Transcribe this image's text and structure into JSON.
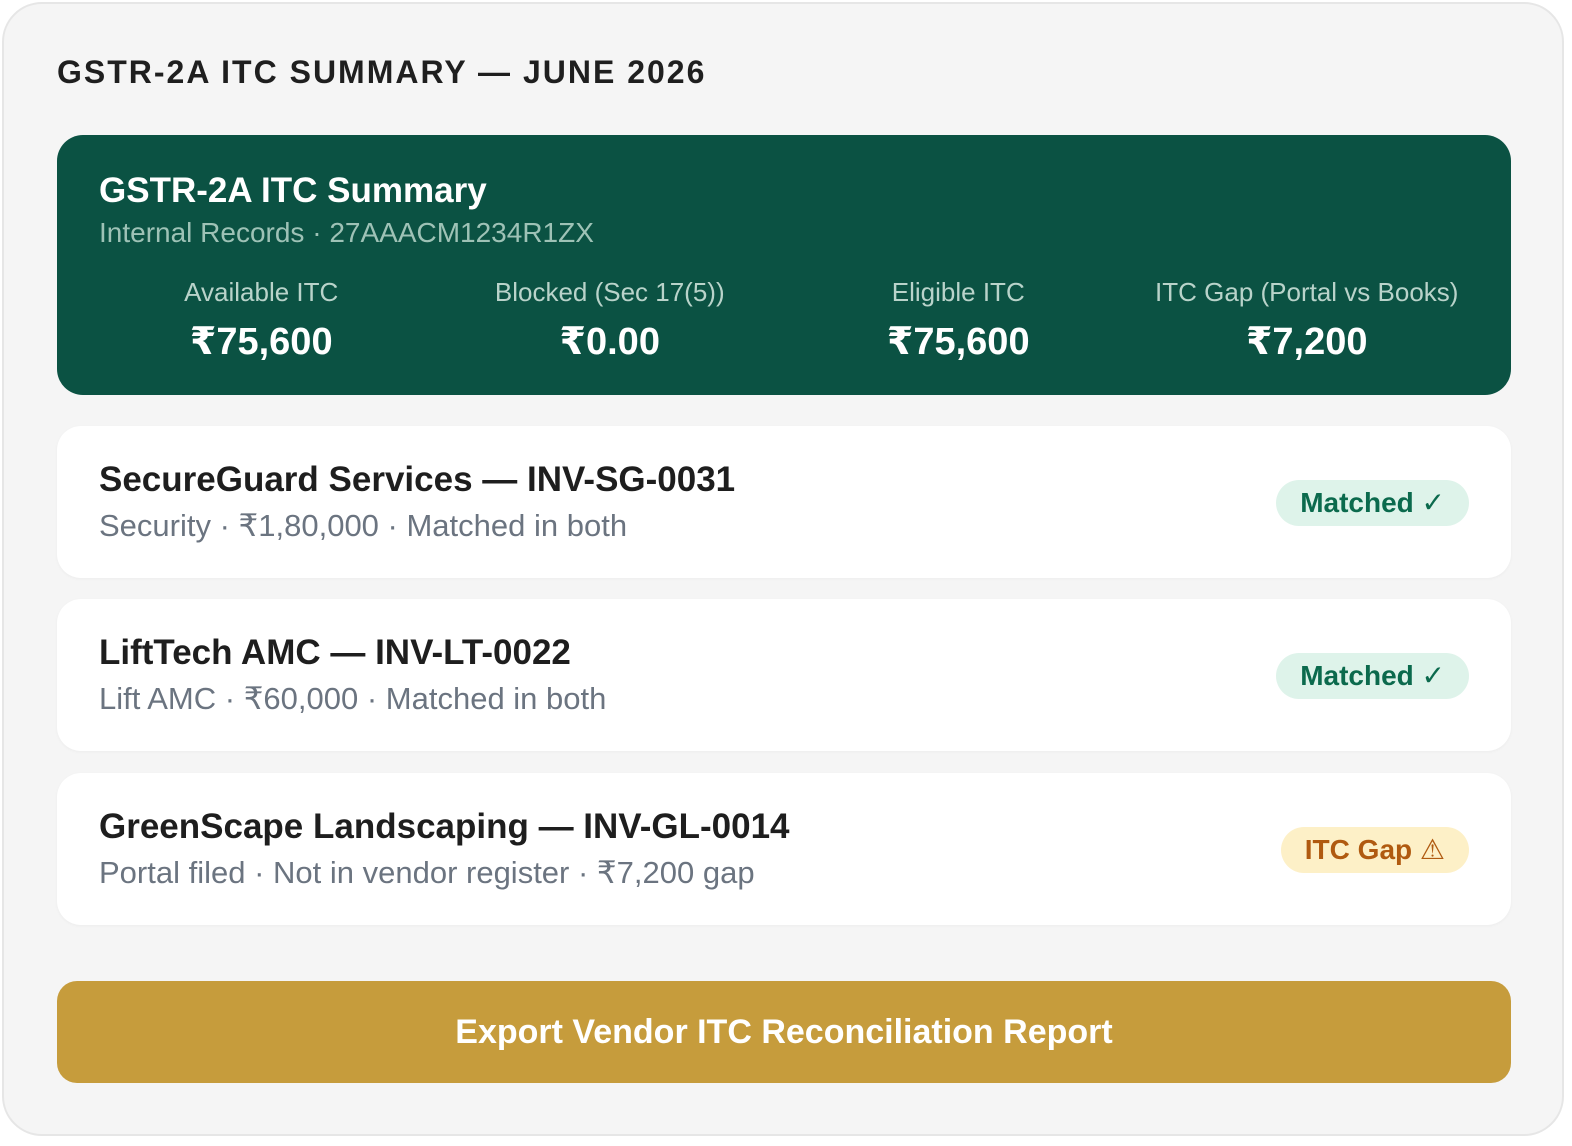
{
  "header": {
    "title": "GSTR-2A ITC SUMMARY — JUNE 2026"
  },
  "summary": {
    "title": "GSTR-2A ITC Summary",
    "subtitle": "Internal Records · 27AAACM1234R1ZX",
    "metrics": [
      {
        "label": "Available ITC",
        "value": "₹75,600"
      },
      {
        "label": "Blocked (Sec 17(5))",
        "value": "₹0.00"
      },
      {
        "label": "Eligible ITC",
        "value": "₹75,600"
      },
      {
        "label": "ITC Gap (Portal vs Books)",
        "value": "₹7,200"
      }
    ]
  },
  "invoices": [
    {
      "title": "SecureGuard Services — INV-SG-0031",
      "detail": "Security · ₹1,80,000 · Matched in both",
      "status": "Matched ✓",
      "status_type": "matched"
    },
    {
      "title": "LiftTech AMC — INV-LT-0022",
      "detail": "Lift AMC · ₹60,000 · Matched in both",
      "status": "Matched ✓",
      "status_type": "matched"
    },
    {
      "title": "GreenScape Landscaping — INV-GL-0014",
      "detail": "Portal filed · Not in vendor register · ₹7,200 gap",
      "status": "ITC Gap ⚠",
      "status_type": "gap"
    }
  ],
  "actions": {
    "export_label": "Export Vendor ITC Reconciliation Report"
  },
  "colors": {
    "summary_bg": "#0b5243",
    "matched_text": "#0b6a4d",
    "matched_bg": "#def3ea",
    "gap_text": "#b05a10",
    "gap_bg": "#fdf0c7",
    "export_button_bg": "#c69c3c"
  }
}
